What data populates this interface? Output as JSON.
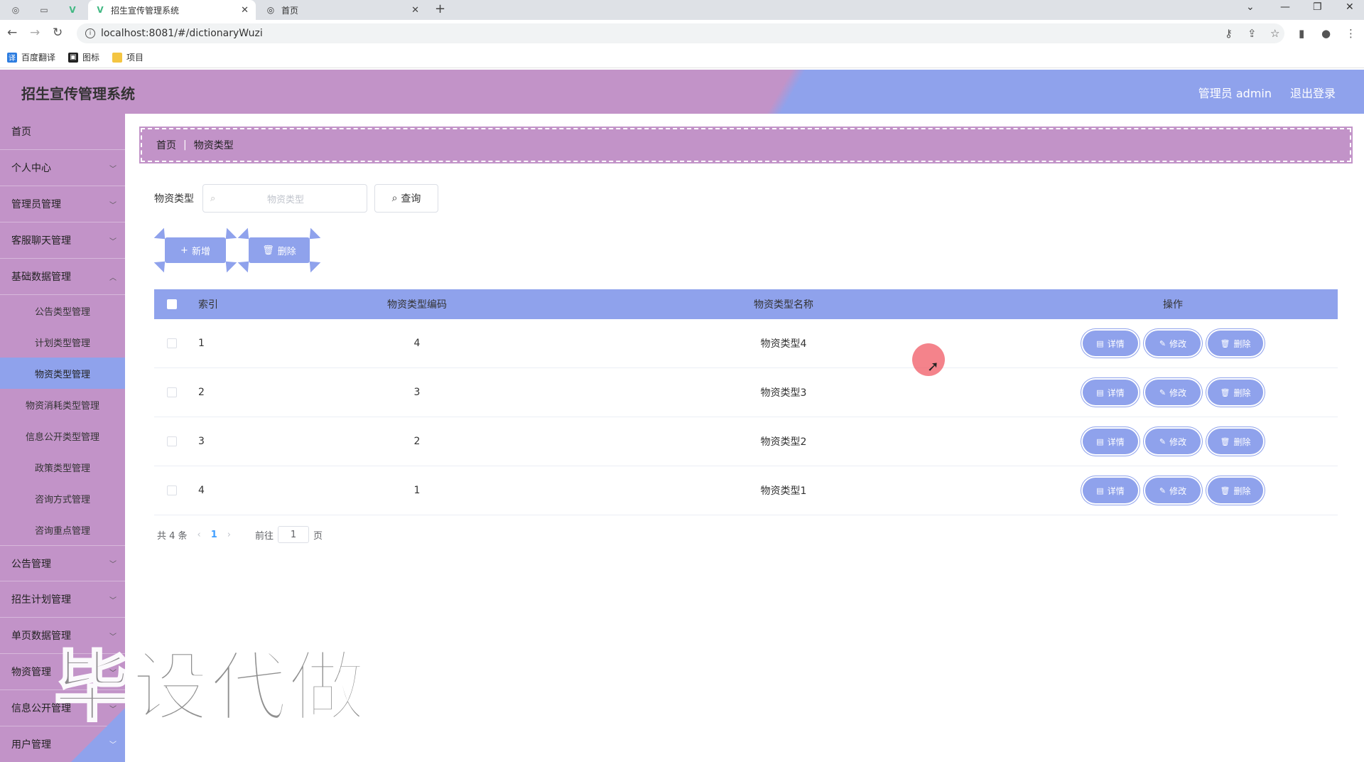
{
  "browser": {
    "tabs": [
      {
        "title": "招生宣传管理系统",
        "active": true
      },
      {
        "title": "首页",
        "active": false
      }
    ],
    "url": "localhost:8081/#/dictionaryWuzi",
    "bookmarks": [
      "百度翻译",
      "图标",
      "项目"
    ]
  },
  "header": {
    "title": "招生宣传管理系统",
    "user": "管理员 admin",
    "logout": "退出登录"
  },
  "sidebar": {
    "items_top": [
      {
        "label": "首页",
        "has_chevron": false
      },
      {
        "label": "个人中心",
        "has_chevron": true
      },
      {
        "label": "管理员管理",
        "has_chevron": true
      },
      {
        "label": "客服聊天管理",
        "has_chevron": true
      },
      {
        "label": "基础数据管理",
        "has_chevron": true
      }
    ],
    "sub_items": [
      {
        "label": "公告类型管理",
        "active": false
      },
      {
        "label": "计划类型管理",
        "active": false
      },
      {
        "label": "物资类型管理",
        "active": true
      },
      {
        "label": "物资消耗类型管理",
        "active": false
      },
      {
        "label": "信息公开类型管理",
        "active": false
      },
      {
        "label": "政策类型管理",
        "active": false
      },
      {
        "label": "咨询方式管理",
        "active": false
      },
      {
        "label": "咨询重点管理",
        "active": false
      }
    ],
    "items_bottom": [
      {
        "label": "公告管理"
      },
      {
        "label": "招生计划管理"
      },
      {
        "label": "单页数据管理"
      },
      {
        "label": "物资管理"
      },
      {
        "label": "信息公开管理"
      }
    ],
    "last_item": "用户管理"
  },
  "breadcrumb": {
    "home": "首页",
    "current": "物资类型"
  },
  "search": {
    "label": "物资类型",
    "placeholder": "物资类型",
    "button": "查询"
  },
  "actions": {
    "add": "新增",
    "delete": "删除"
  },
  "table": {
    "headers": {
      "index": "索引",
      "code": "物资类型编码",
      "name": "物资类型名称",
      "ops": "操作"
    },
    "rows": [
      {
        "index": "1",
        "code": "4",
        "name": "物资类型4"
      },
      {
        "index": "2",
        "code": "3",
        "name": "物资类型3"
      },
      {
        "index": "3",
        "code": "2",
        "name": "物资类型2"
      },
      {
        "index": "4",
        "code": "1",
        "name": "物资类型1"
      }
    ],
    "row_actions": {
      "detail": "详情",
      "edit": "修改",
      "delete": "删除"
    }
  },
  "pagination": {
    "total": "共 4 条",
    "current_page": "1",
    "goto_label": "前往",
    "goto_value": "1",
    "page_suffix": "页"
  },
  "watermark": "毕设代做",
  "colors": {
    "purple": "#c293c8",
    "blue": "#8fa2ec"
  }
}
